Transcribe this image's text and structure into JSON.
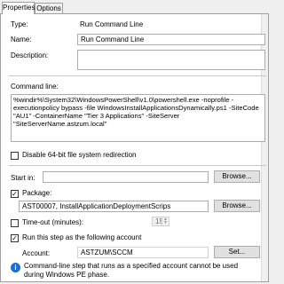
{
  "tabs": {
    "properties": "Properties",
    "options": "Options"
  },
  "type": {
    "label": "Type:",
    "value": "Run Command Line"
  },
  "name": {
    "label": "Name:",
    "value": "Run Command Line"
  },
  "description": {
    "label": "Description:",
    "value": ""
  },
  "command_line": {
    "label": "Command line:",
    "value": "%windir%\\System32\\WindowsPowerShell\\v1.0\\powershell.exe -noprofile -executionpolicy bypass -file WindowsInstallApplicationsDynamically.ps1 -SiteCode \"AU1\" -ContainerName \"Tier 3 Applications\" -SiteServer \"SiteServerName.astzum.local\""
  },
  "disable_redirection": {
    "label": "Disable 64-bit file system redirection",
    "checked": false
  },
  "start_in": {
    "label": "Start in:",
    "value": "",
    "browse": "Browse..."
  },
  "package": {
    "label": "Package:",
    "checked": true,
    "value": "AST00007, InstallApplicationDeploymentScrips",
    "browse": "Browse..."
  },
  "timeout": {
    "label": "Time-out (minutes):",
    "checked": false,
    "value": "15"
  },
  "run_as": {
    "label": "Run this step as the following account",
    "checked": true
  },
  "account": {
    "label": "Account:",
    "value": "ASTZUM\\SCCM",
    "set": "Set..."
  },
  "info": {
    "icon": "info-icon",
    "text": "Command-line step that runs as a specified account cannot be used during Windows PE phase."
  }
}
